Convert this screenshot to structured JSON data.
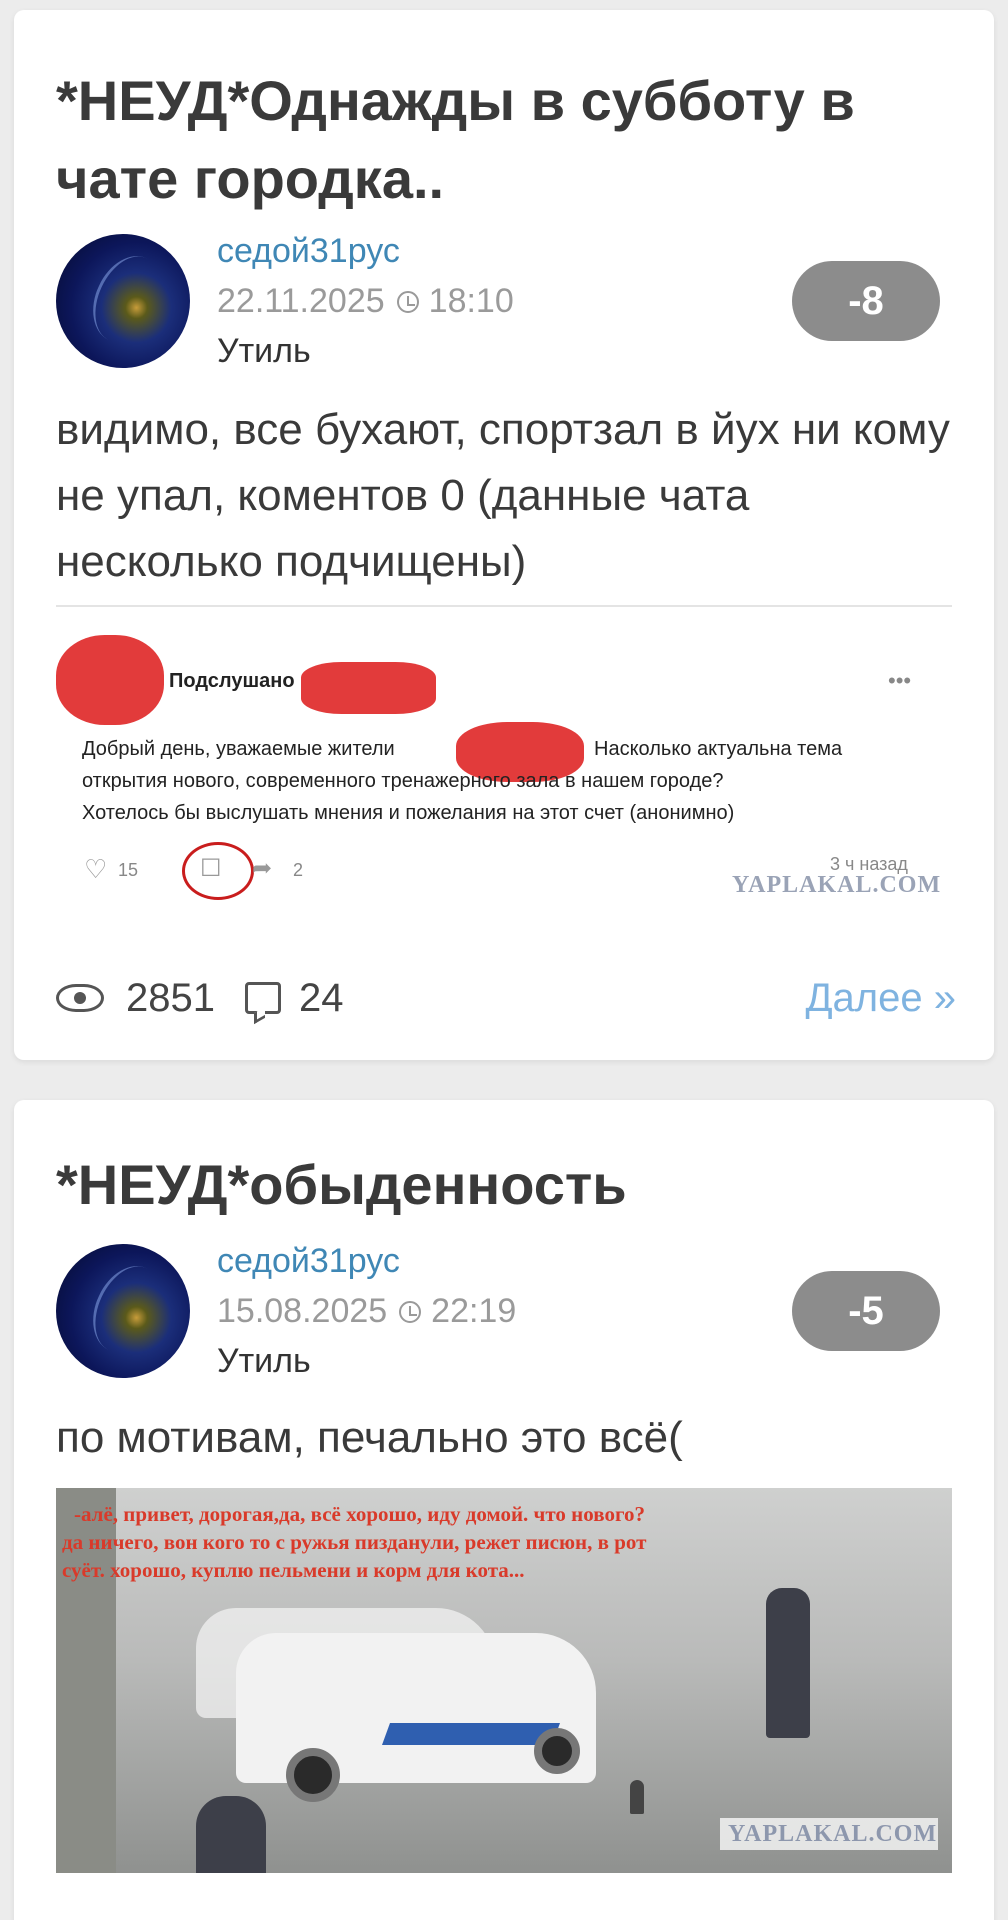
{
  "posts": [
    {
      "title": "*НЕУД*Однажды в субботу в чате городка..",
      "author": "седой31рус",
      "date": "22.11.2025",
      "time": "18:10",
      "category": "Утиль",
      "rating": "-8",
      "text": "видимо, все бухают, спортзал в йух ни кому не упал, коментов 0 (данные чата несколько подчищены)",
      "image": {
        "group_name": "Подслушано",
        "message_line1": "Добрый день, уважаемые жители",
        "message_line1b": "Насколько актуальна тема",
        "message_line2": "открытия нового, современного тренажерного зала в нашем городе?",
        "message_line3": "Хотелось бы выслушать мнения и пожелания на этот счет (анонимно)",
        "likes": "15",
        "shares": "2",
        "time_ago": "3 ч назад",
        "watermark": "YAPLAKAL.COM",
        "menu": "•••"
      },
      "views": "2851",
      "comments": "24",
      "more_label": "Далее »"
    },
    {
      "title": "*НЕУД*обыденность",
      "author": "седой31рус",
      "date": "15.08.2025",
      "time": "22:19",
      "category": "Утиль",
      "rating": "-5",
      "text": "по мотивам, печально это всё(",
      "image": {
        "caption_line1": "-алё, привет, дорогая,да, всё хорошо, иду домой. что нового?",
        "caption_line2": "да ничего, вон  кого то с ружья пизданули, режет писюн, в рот",
        "caption_line3": "суёт. хорошо, куплю пельмени и корм для кота...",
        "watermark": "YAPLAKAL.COM"
      }
    }
  ],
  "colors": {
    "author": "#3f87b5",
    "rating_bg": "#8c8c8c",
    "more_link": "#7fb3e0",
    "page_bg": "#ececec"
  }
}
